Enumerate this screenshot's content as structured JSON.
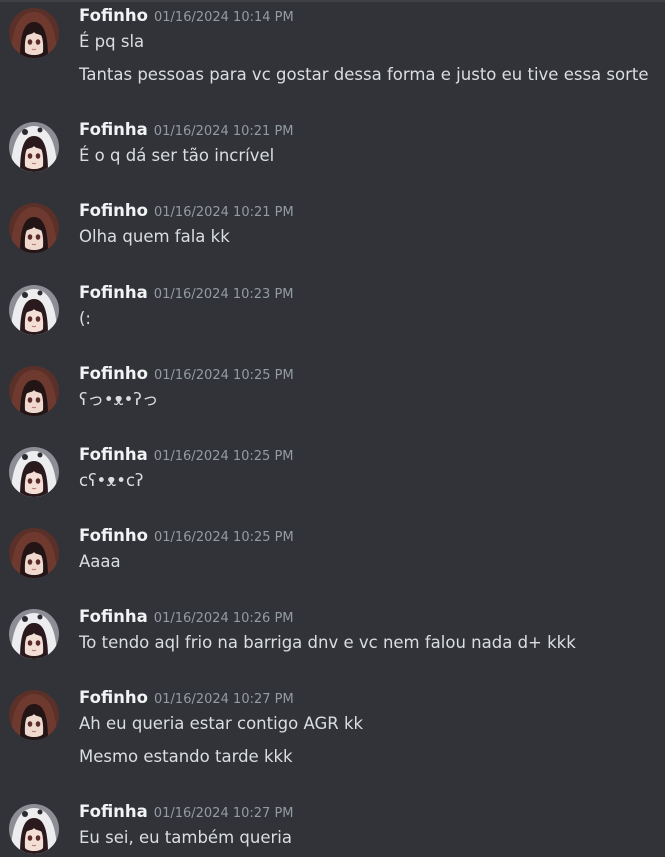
{
  "messages": [
    {
      "author": "Fofinho",
      "time": "01/16/2024 10:14 PM",
      "avatar_icon": "dark-hood-girl-avatar-icon",
      "lines": [
        "É pq sla",
        "Tantas pessoas para vc gostar dessa forma e justo eu tive essa sorte"
      ]
    },
    {
      "author": "Fofinha",
      "time": "01/16/2024 10:21 PM",
      "avatar_icon": "white-hood-girl-avatar-icon",
      "lines": [
        "É o q dá ser tão incrível"
      ]
    },
    {
      "author": "Fofinho",
      "time": "01/16/2024 10:21 PM",
      "avatar_icon": "dark-hood-girl-avatar-icon",
      "lines": [
        "Olha quem fala kk"
      ]
    },
    {
      "author": "Fofinha",
      "time": "01/16/2024 10:23 PM",
      "avatar_icon": "white-hood-girl-avatar-icon",
      "lines": [
        "(:"
      ]
    },
    {
      "author": "Fofinho",
      "time": "01/16/2024 10:25 PM",
      "avatar_icon": "dark-hood-girl-avatar-icon",
      "lines": [
        "ʕっ•ᴥ•ʔっ"
      ]
    },
    {
      "author": "Fofinha",
      "time": "01/16/2024 10:25 PM",
      "avatar_icon": "white-hood-girl-avatar-icon",
      "lines": [
        "cʕ•ᴥ•cʔ"
      ]
    },
    {
      "author": "Fofinho",
      "time": "01/16/2024 10:25 PM",
      "avatar_icon": "dark-hood-girl-avatar-icon",
      "lines": [
        "Aaaa"
      ]
    },
    {
      "author": "Fofinha",
      "time": "01/16/2024 10:26 PM",
      "avatar_icon": "white-hood-girl-avatar-icon",
      "lines": [
        "To tendo aql frio na barriga dnv e vc nem falou nada d+ kkk"
      ]
    },
    {
      "author": "Fofinho",
      "time": "01/16/2024 10:27 PM",
      "avatar_icon": "dark-hood-girl-avatar-icon",
      "lines": [
        "Ah eu queria estar contigo AGR kk",
        "Mesmo estando tarde kkk"
      ]
    },
    {
      "author": "Fofinha",
      "time": "01/16/2024 10:27 PM",
      "avatar_icon": "white-hood-girl-avatar-icon",
      "lines": [
        "Eu sei, eu também queria"
      ]
    }
  ]
}
